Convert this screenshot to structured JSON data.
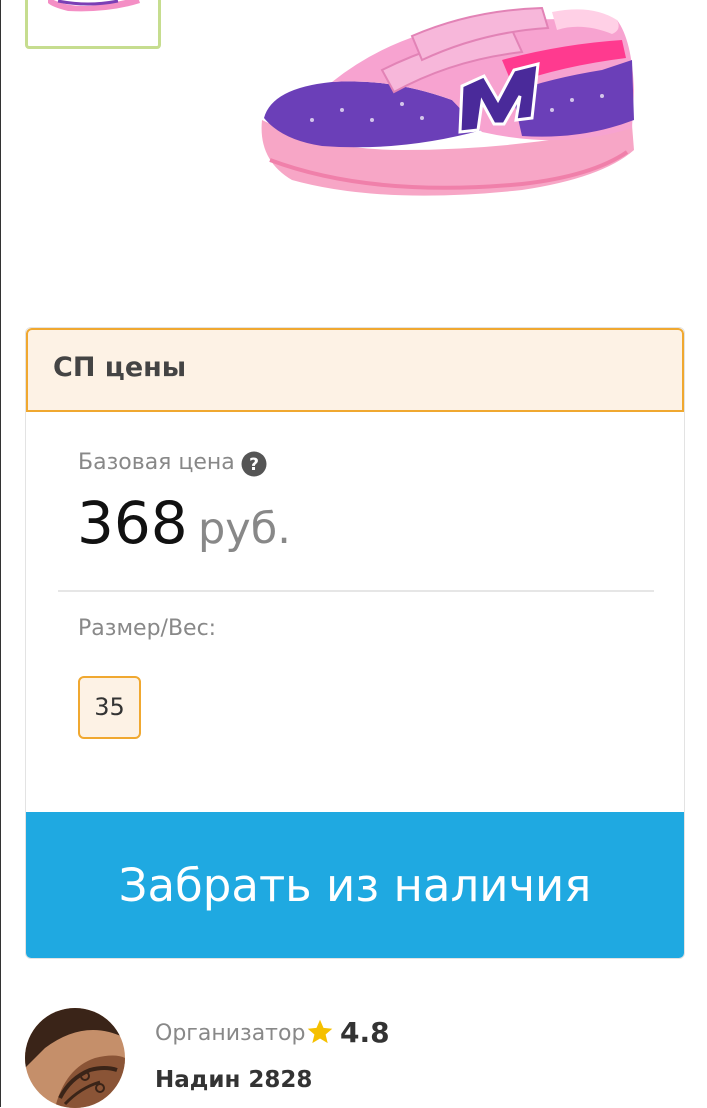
{
  "gallery": {
    "thumbnail_icon": "sneaker-thumbnail",
    "main_image_icon": "pink-purple-velcro-sneaker",
    "thumb_border_color": "#c6dd8f"
  },
  "prices": {
    "title": "СП цены",
    "base_price_label": "Базовая цена",
    "help_icon": "question-circle-icon",
    "price_value": "368",
    "currency": "руб.",
    "size_label": "Размер/Вес:",
    "sizes": [
      "35"
    ],
    "accent_color": "#f0a830",
    "header_bg": "#fdf2e5"
  },
  "action": {
    "button_label": "Забрать из наличия",
    "button_color": "#1fa9e1"
  },
  "organizer": {
    "label": "Организатор",
    "star_icon": "star-icon",
    "rating": "4.8",
    "name": "Надин 2828"
  }
}
